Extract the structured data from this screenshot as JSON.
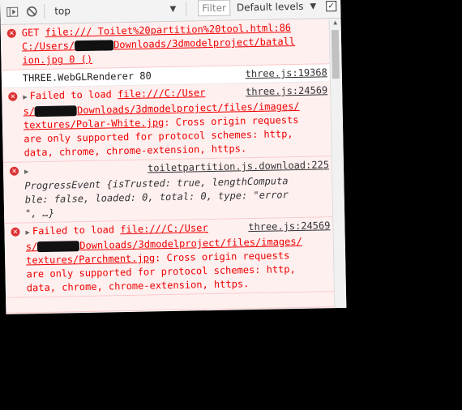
{
  "toolbar": {
    "context": "top",
    "filter_placeholder": "Filter",
    "levels": "Default levels"
  },
  "messages": [
    {
      "type": "error",
      "prefix": "GET ",
      "link": "file:///",
      "line1_rest": " Toilet%20partition%20tool.html:86",
      "line2_a": "C:/Users/",
      "line2_b": "Downloads/3dmodelproject/batall",
      "line3": "ion.jpg 0 ()"
    },
    {
      "type": "log",
      "text": "THREE.WebGLRenderer 80",
      "source": "three.js:19368"
    },
    {
      "type": "error",
      "prefix": "Failed to load ",
      "link1": "file:///C:/User",
      "source": "three.js:24569",
      "link2a": "s/",
      "link2b": "Downloads/3dmodelproject/files/images/",
      "link3": "textures/Polar-White.jpg",
      "rest1": ": Cross origin requests",
      "rest2": "are only supported for protocol schemes: http,",
      "rest3": "data, chrome, chrome-extension, https."
    },
    {
      "type": "error",
      "source": "toiletpartition.js.download:225",
      "obj_name": "ProgressEvent ",
      "line1": "{isTrusted: true, lengthComputa",
      "line2": "ble: false, loaded: 0, total: 0, type: \"error",
      "line3": "\", …}"
    },
    {
      "type": "error",
      "prefix": "Failed to load ",
      "link1": "file:///C:/User",
      "source": "three.js:24569",
      "link2a": "s/",
      "link2b": "Downloads/3dmodelproject/files/images/",
      "link3": "textures/Parchment.jpg",
      "rest1": ": Cross origin requests",
      "rest2": "are only supported for protocol schemes: http,",
      "rest3": "data, chrome, chrome-extension, https."
    }
  ],
  "colors": {
    "error_bg": "#fff0f0",
    "error_text": "#e00000",
    "boolean": "#1a1aa6",
    "string": "#c41a16"
  }
}
